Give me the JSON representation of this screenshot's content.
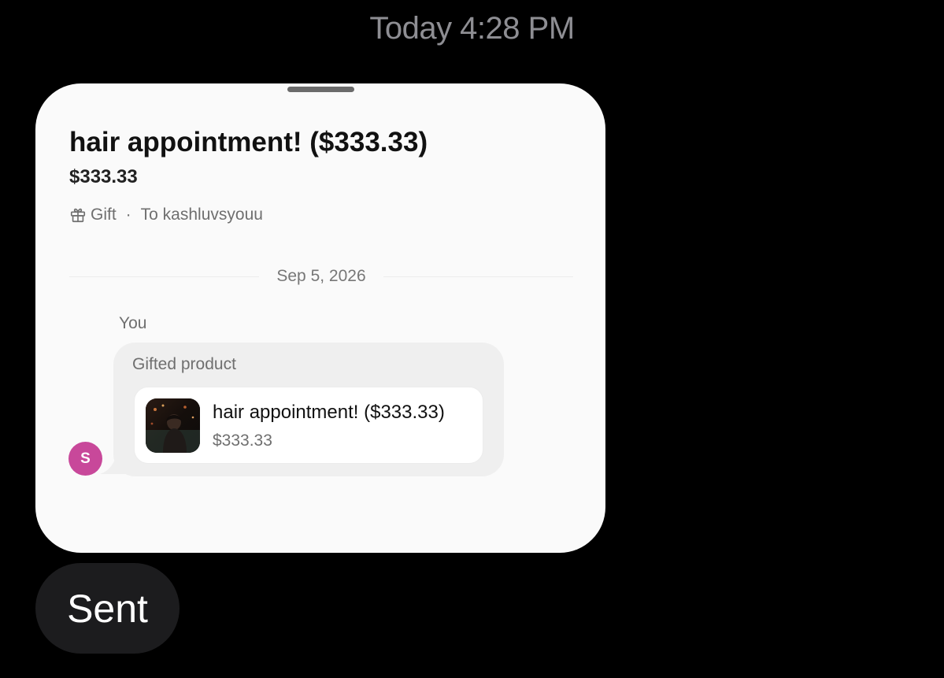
{
  "timestamp": "Today 4:28 PM",
  "card": {
    "title": "hair appointment! ($333.33)",
    "price": "$333.33",
    "meta": {
      "icon": "gift-icon",
      "type_label": "Gift",
      "separator": "·",
      "recipient": "To kashluvsyouu"
    },
    "date_divider": "Sep 5, 2026",
    "sender_label": "You",
    "bubble": {
      "label": "Gifted product",
      "product": {
        "title": "hair appointment! ($333.33)",
        "price": "$333.33"
      }
    },
    "avatar_initial": "S"
  },
  "status": "Sent",
  "colors": {
    "background": "#000000",
    "card": "#fafafa",
    "avatar": "#c8489a",
    "pill": "#1c1c1e"
  }
}
